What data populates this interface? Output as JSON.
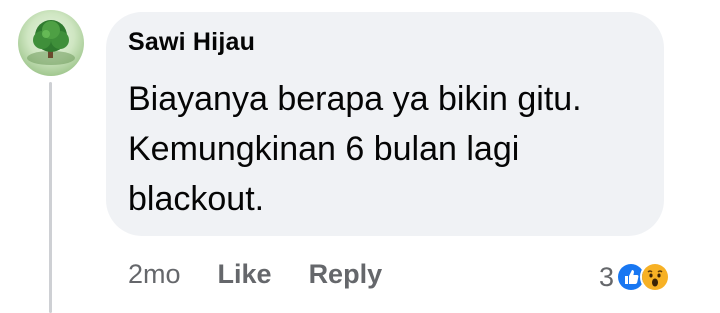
{
  "comment": {
    "author": "Sawi Hijau",
    "body_lines": [
      "Biayanya berapa ya bikin gitu.",
      "Kemungkinan 6 bulan lagi",
      "blackout."
    ],
    "timestamp": "2mo",
    "like_label": "Like",
    "reply_label": "Reply",
    "reaction_count": "3",
    "reaction_icons": [
      "like-icon",
      "wow-icon"
    ]
  },
  "colors": {
    "bubble": "#f0f2f5",
    "meta_text": "#65676b",
    "like_blue": "#1877f2",
    "wow_yellow": "#f7b125"
  }
}
